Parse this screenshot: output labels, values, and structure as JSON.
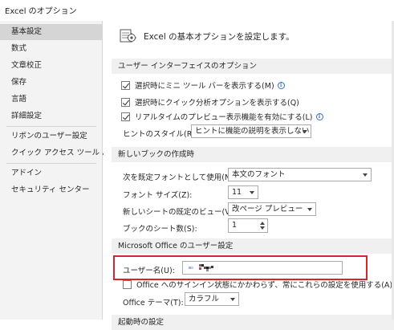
{
  "window": {
    "title": "Excel のオプション"
  },
  "sidebar": {
    "items": [
      {
        "label": "基本設定"
      },
      {
        "label": "数式"
      },
      {
        "label": "文章校正"
      },
      {
        "label": "保存"
      },
      {
        "label": "言語"
      },
      {
        "label": "詳細設定"
      },
      {
        "label": "リボンのユーザー設定"
      },
      {
        "label": "クイック アクセス ツール バー"
      },
      {
        "label": "アドイン"
      },
      {
        "label": "セキュリティ センター"
      }
    ]
  },
  "main": {
    "header": "Excel の基本オプションを設定します。",
    "ui_section": {
      "title": "ユーザー インターフェイスのオプション",
      "mini_toolbar": {
        "label": "選択時にミニ ツール バーを表示する(M)",
        "checked": true
      },
      "quick_analysis": {
        "label": "選択時にクイック分析オプションを表示する(Q)",
        "checked": true
      },
      "live_preview": {
        "label": "リアルタイムのプレビュー表示機能を有効にする(L)",
        "checked": true
      },
      "tooltip_style": {
        "label": "ヒントのスタイル(R):",
        "value": "ヒントに機能の説明を表示しない"
      }
    },
    "workbook_section": {
      "title": "新しいブックの作成時",
      "default_font": {
        "label": "次を既定フォントとして使用(N):",
        "value": "本文のフォント"
      },
      "font_size": {
        "label": "フォント サイズ(Z):",
        "value": "11"
      },
      "default_view": {
        "label": "新しいシートの既定のビュー(V):",
        "value": "改ページ プレビュー"
      },
      "sheet_count": {
        "label": "ブックのシート数(S):",
        "value": "1"
      }
    },
    "personalize_section": {
      "title": "Microsoft Office のユーザー設定",
      "username": {
        "label": "ユーザー名(U):"
      },
      "always_use": {
        "label": "Office へのサインイン状態にかかわらず、常にこれらの設定を使用する(A)",
        "checked": false
      },
      "theme": {
        "label": "Office テーマ(T):",
        "value": "カラフル"
      }
    },
    "next_section": {
      "title": "起動時の設定"
    }
  },
  "colors": {
    "highlight_border": "#d7252c",
    "sidebar_bg": "#f3f3f3",
    "sidebar_selected": "#d5d5d5",
    "section_bg": "#f0f0f0",
    "info_icon": "#2f6fbf"
  }
}
